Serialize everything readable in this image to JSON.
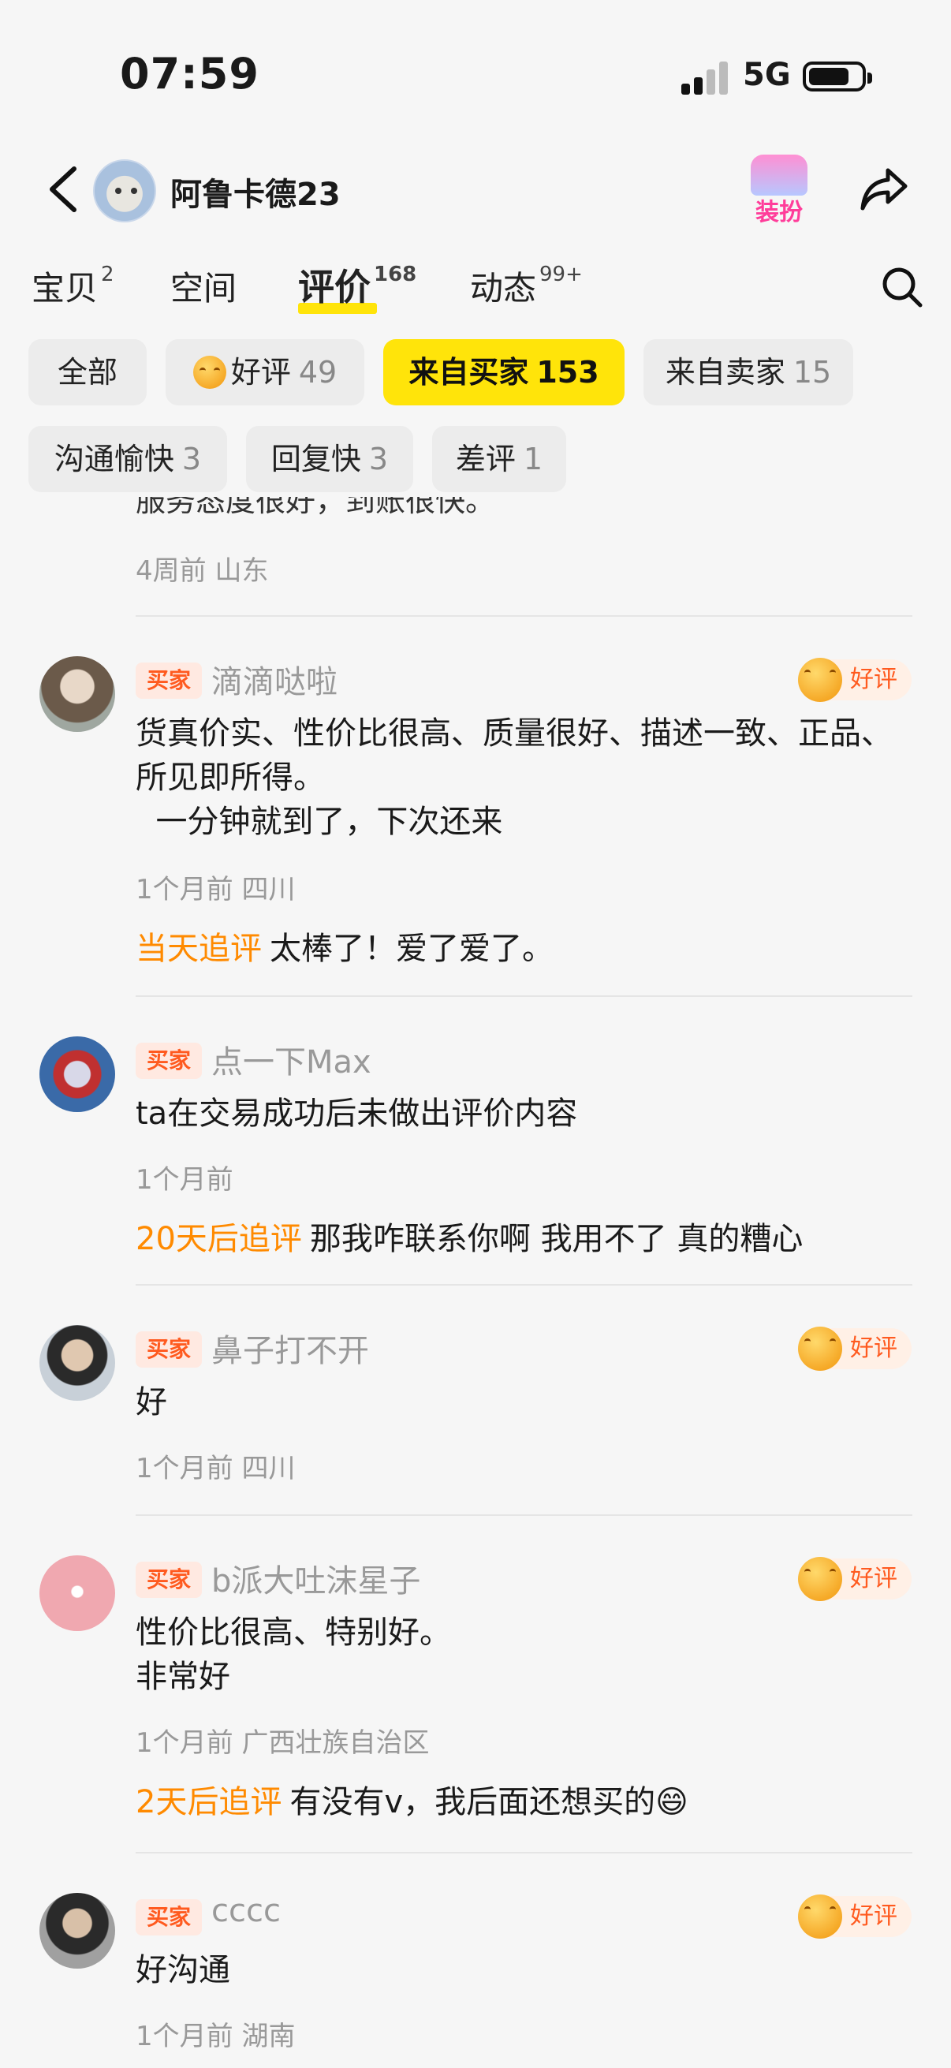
{
  "status": {
    "time": "07:59",
    "network": "5G"
  },
  "header": {
    "shop_name": "阿鲁卡德23",
    "dress_label": "装扮"
  },
  "tabs": [
    {
      "label": "宝贝",
      "count": "2"
    },
    {
      "label": "空间",
      "count": ""
    },
    {
      "label": "评价",
      "count": "168"
    },
    {
      "label": "动态",
      "count": "99+"
    }
  ],
  "filters": [
    {
      "label": "全部",
      "count": ""
    },
    {
      "label": "好评",
      "count": "49"
    },
    {
      "label": "来自买家",
      "count": "153"
    },
    {
      "label": "来自卖家",
      "count": "15"
    },
    {
      "label": "沟通愉快",
      "count": "3"
    },
    {
      "label": "回复快",
      "count": "3"
    },
    {
      "label": "差评",
      "count": "1"
    }
  ],
  "active_filter": "来自买家",
  "buyer_tag": "买家",
  "good_badge": "好评",
  "partial_review": {
    "text": "服务态度很好，到账很快。",
    "meta": "4周前  山东"
  },
  "reviews": [
    {
      "user": "滴滴哒啦",
      "good": true,
      "text": "货真价实、性价比很高、质量很好、描述一致、正品、所见即所得。\n  一分钟就到了，下次还来",
      "meta": "1个月前  四川",
      "follow_label": "当天追评",
      "follow_text": "太棒了！爱了爱了。"
    },
    {
      "user": "点一下Max",
      "good": false,
      "text": "ta在交易成功后未做出评价内容",
      "meta": "1个月前",
      "follow_label": "20天后追评",
      "follow_text": "那我咋联系你啊 我用不了 真的糟心"
    },
    {
      "user": "鼻子打不开",
      "good": true,
      "text": "好",
      "meta": "1个月前  四川",
      "follow_label": "",
      "follow_text": ""
    },
    {
      "user": "b派大吐沫星子",
      "good": true,
      "text": "性价比很高、特别好。\n非常好",
      "meta": "1个月前  广西壮族自治区",
      "follow_label": "2天后追评",
      "follow_text": "有没有v，我后面还想买的😄"
    },
    {
      "user": "cccc",
      "good": true,
      "text": "好沟通",
      "meta": "1个月前  湖南",
      "follow_label": "",
      "follow_text": ""
    }
  ]
}
